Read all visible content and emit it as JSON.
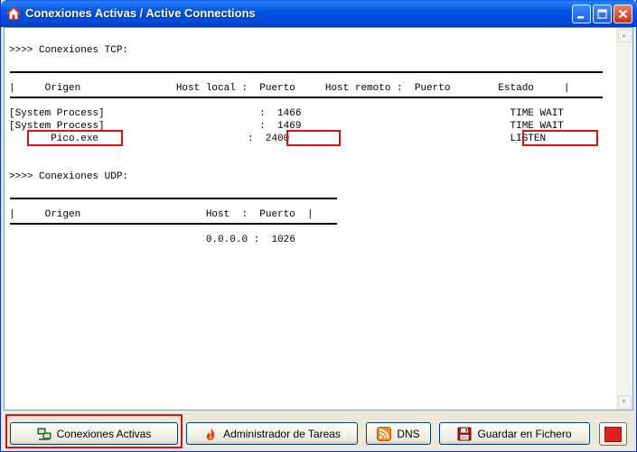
{
  "window": {
    "title": "Conexiones Activas / Active Connections"
  },
  "tcp": {
    "heading": ">>>> Conexiones TCP:",
    "header": "|     Origen                Host local :  Puerto     Host remoto :  Puerto        Estado     |",
    "rows": [
      "[System Process]                          :  1466                                   TIME WAIT",
      "[System Process]                          :  1469                                   TIME WAIT",
      "       Pico.exe                         :  2400                                     LISTEN"
    ]
  },
  "udp": {
    "heading": ">>>> Conexiones UDP:",
    "header": "|     Origen                     Host  :  Puerto  |",
    "rows": [
      "                                 0.0.0.0 :  1026"
    ]
  },
  "buttons": {
    "conexiones": "Conexiones Activas",
    "administrador": "Administrador de Tareas",
    "dns": "DNS",
    "guardar": "Guardar en Fichero"
  }
}
